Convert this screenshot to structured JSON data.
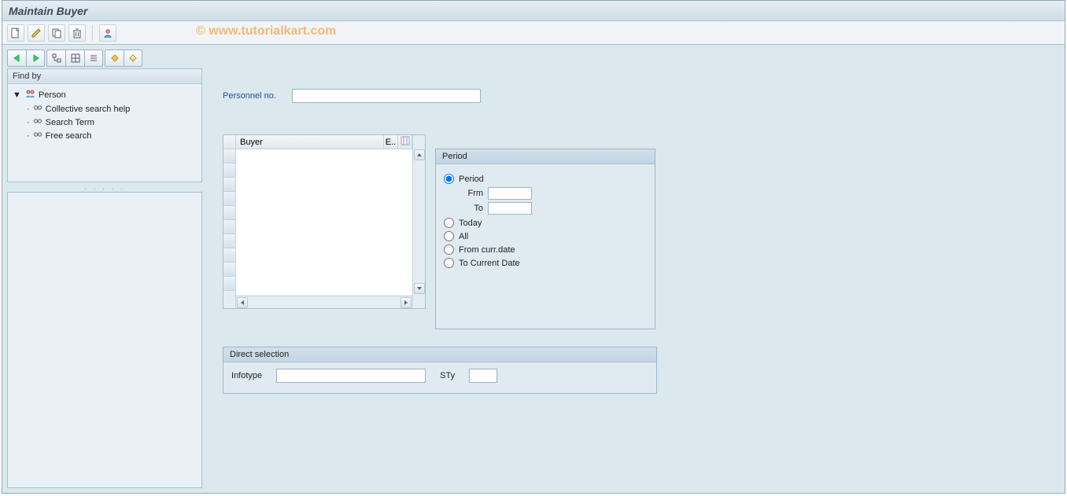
{
  "title": "Maintain Buyer",
  "watermark": "© www.tutorialkart.com",
  "toolbar": {
    "create": "create",
    "change": "change",
    "copy": "copy",
    "delete": "delete",
    "overview": "overview"
  },
  "sidebar": {
    "findby_title": "Find by",
    "tree": {
      "root": "Person",
      "children": [
        "Collective search help",
        "Search Term",
        "Free search"
      ]
    }
  },
  "main": {
    "personnel_label": "Personnel no.",
    "personnel_value": ""
  },
  "buyerPanel": {
    "col_buyer": "Buyer",
    "col_e": "E.."
  },
  "period": {
    "title": "Period",
    "opt_period": "Period",
    "frm_label": "Frm",
    "frm_value": "",
    "to_label": "To",
    "to_value": "",
    "opt_today": "Today",
    "opt_all": "All",
    "opt_from_curr": "From curr.date",
    "opt_to_curr": "To Current Date",
    "selected": "period"
  },
  "direct": {
    "title": "Direct selection",
    "infotype_label": "Infotype",
    "infotype_value": "",
    "sty_label": "STy",
    "sty_value": ""
  }
}
